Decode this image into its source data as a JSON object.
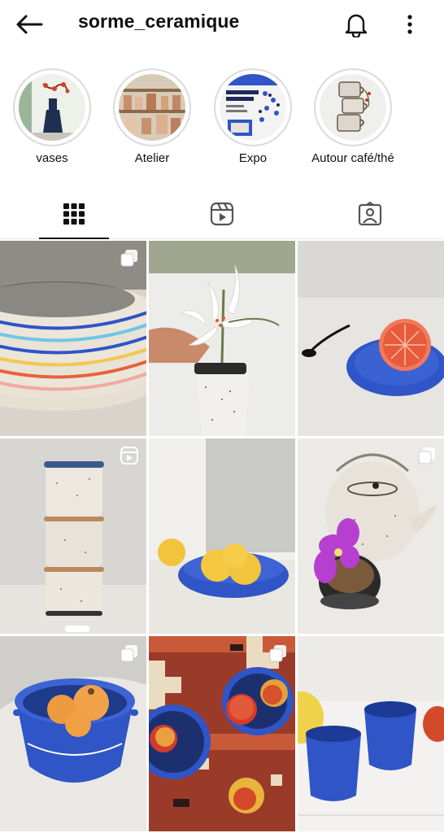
{
  "header": {
    "username": "sorme_ceramique",
    "back_icon": "arrow-left-icon",
    "bell_icon": "bell-icon",
    "more_icon": "more-vertical-icon"
  },
  "highlights": [
    {
      "label": "vases"
    },
    {
      "label": "Atelier"
    },
    {
      "label": "Expo"
    },
    {
      "label": "Autour café/thé"
    }
  ],
  "tabs": [
    {
      "name": "grid",
      "icon": "grid-icon",
      "active": true
    },
    {
      "name": "reels",
      "icon": "reels-icon",
      "active": false
    },
    {
      "name": "tagged",
      "icon": "tagged-icon",
      "active": false
    }
  ],
  "posts": [
    {
      "subject": "stacked speckled plates with colored rims",
      "badge": "carousel-icon"
    },
    {
      "subject": "white lilies in speckled vase",
      "badge": ""
    },
    {
      "subject": "grapefruit on blue plate with spoon",
      "badge": ""
    },
    {
      "subject": "stacked speckled cups",
      "badge": "reels-icon"
    },
    {
      "subject": "lemons in blue bowl",
      "badge": ""
    },
    {
      "subject": "teapot with orchid and bowls",
      "badge": "carousel-icon"
    },
    {
      "subject": "mini pumpkins in blue casserole",
      "badge": "carousel-icon"
    },
    {
      "subject": "apples on blue plates on rug",
      "badge": "carousel-icon"
    },
    {
      "subject": "blue cups with fruit",
      "badge": ""
    }
  ],
  "colors": {
    "accent_blue": "#2f55c6",
    "border": "#dbdbdb",
    "text": "#111111"
  }
}
